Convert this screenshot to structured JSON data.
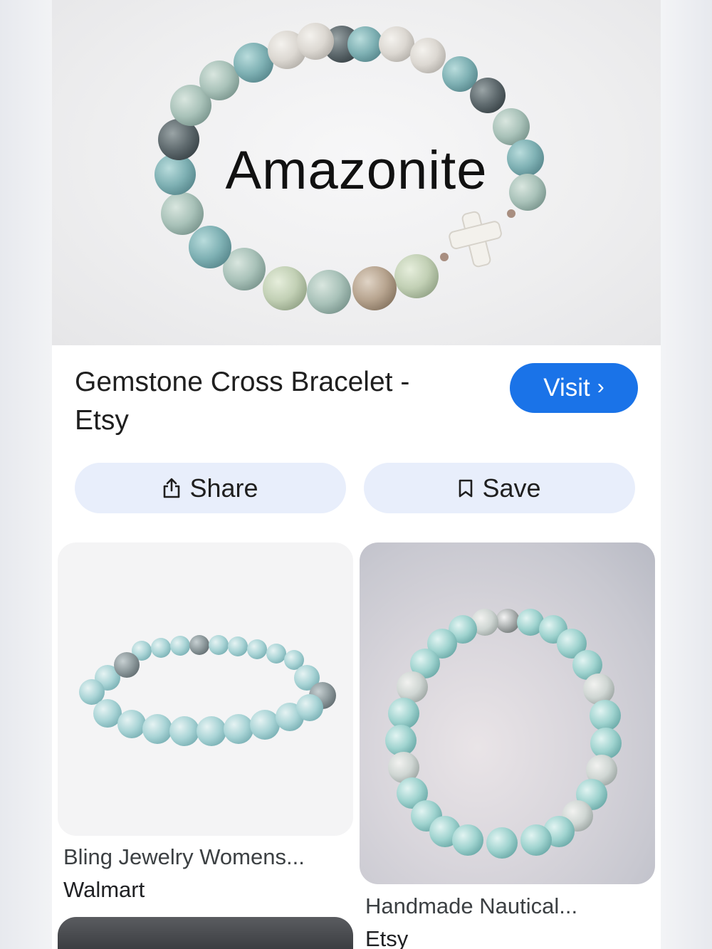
{
  "hero": {
    "caption": "Amazonite"
  },
  "result": {
    "title_line1": "Gemstone Cross Bracelet -",
    "title_line2": "Etsy",
    "visit_label": "Visit",
    "visit_chevron": "›"
  },
  "actions": {
    "share_label": "Share",
    "save_label": "Save",
    "share_icon": "share-icon",
    "save_icon": "bookmark-icon"
  },
  "related": [
    {
      "title": "Bling Jewelry Womens...",
      "source": "Walmart"
    },
    {
      "title": "Handmade Nautical...",
      "source": "Etsy"
    }
  ],
  "colors": {
    "accent": "#1a73e8",
    "button_bg": "#e8eefb"
  }
}
